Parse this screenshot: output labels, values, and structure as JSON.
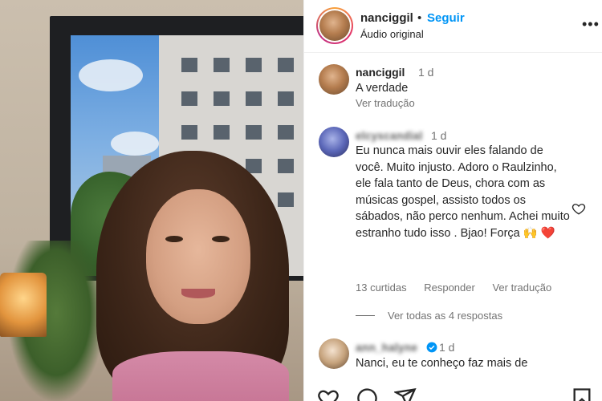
{
  "header": {
    "username": "nanciggil",
    "separator": "•",
    "follow_label": "Seguir",
    "subtitle": "Áudio original",
    "more_label": "•••"
  },
  "comments": [
    {
      "username": "nanciggil",
      "time": "1 d",
      "text": "A verdade",
      "translate": "Ver tradução"
    },
    {
      "username": "elcyscandial",
      "time": "1 d",
      "text": "Eu nunca mais ouvir eles falando de você. Muito injusto. Adoro o Raulzinho, ele fala tanto de Deus, chora com as músicas gospel, assisto todos os sábados, não perco nenhum. Achei muito estranho tudo isso . Bjao! Força 🙌 ❤️",
      "likes": "13 curtidas",
      "reply": "Responder",
      "translate": "Ver tradução",
      "view_replies": "Ver todas as 4 respostas"
    },
    {
      "username": "ann_halyne",
      "time": "1 d",
      "text": "Nanci, eu te conheço faz mais de"
    }
  ],
  "icons": {
    "heart": "heart-outline-icon",
    "verified": "verified-badge-icon",
    "like": "heart-outline-icon",
    "comment": "comment-icon",
    "share": "send-icon",
    "save": "bookmark-icon"
  },
  "colors": {
    "follow": "#0095f6",
    "muted": "#737373",
    "text": "#262626"
  }
}
